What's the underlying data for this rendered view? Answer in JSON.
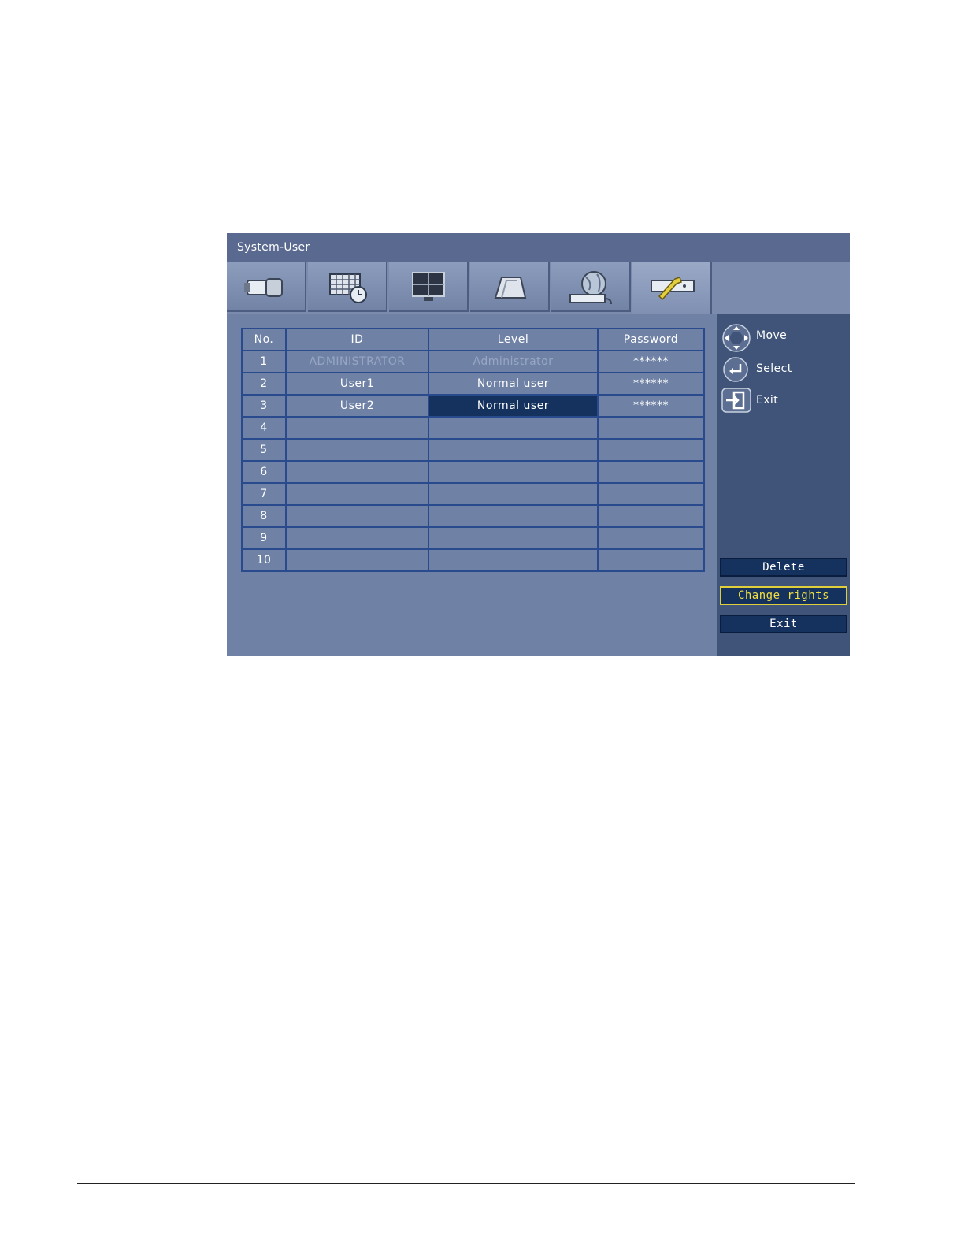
{
  "screen": {
    "title": "System-User",
    "tabs": [
      {
        "icon": "camera-icon"
      },
      {
        "icon": "schedule-icon"
      },
      {
        "icon": "monitor-icon"
      },
      {
        "icon": "alarm-icon"
      },
      {
        "icon": "network-icon"
      },
      {
        "icon": "system-tools-icon",
        "active": true
      }
    ],
    "table": {
      "headers": {
        "no": "No.",
        "id": "ID",
        "level": "Level",
        "password": "Password"
      },
      "rows": [
        {
          "no": "1",
          "id": "ADMINISTRATOR",
          "level": "Administrator",
          "password": "******"
        },
        {
          "no": "2",
          "id": "User1",
          "level": "Normal user",
          "password": "******"
        },
        {
          "no": "3",
          "id": "User2",
          "level": "Normal user",
          "password": "******"
        },
        {
          "no": "4",
          "id": "",
          "level": "",
          "password": ""
        },
        {
          "no": "5",
          "id": "",
          "level": "",
          "password": ""
        },
        {
          "no": "6",
          "id": "",
          "level": "",
          "password": ""
        },
        {
          "no": "7",
          "id": "",
          "level": "",
          "password": ""
        },
        {
          "no": "8",
          "id": "",
          "level": "",
          "password": ""
        },
        {
          "no": "9",
          "id": "",
          "level": "",
          "password": ""
        },
        {
          "no": "10",
          "id": "",
          "level": "",
          "password": ""
        }
      ]
    },
    "legend": {
      "move": "Move",
      "select": "Select",
      "exit": "Exit"
    },
    "buttons": {
      "delete": "Delete",
      "change_rights": "Change rights",
      "exit": "Exit"
    },
    "colors": {
      "selected_cell": "#15325e",
      "focus_yellow": "#f2df40"
    }
  }
}
